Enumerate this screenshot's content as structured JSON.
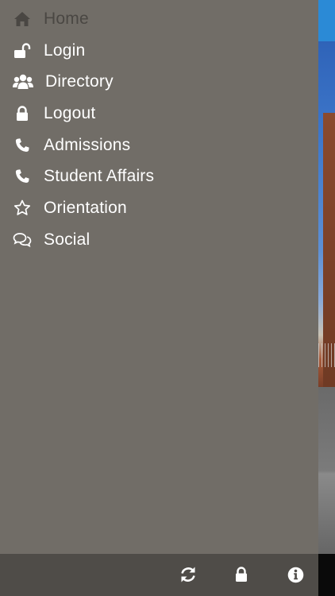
{
  "menu": {
    "items": [
      {
        "label": "Home",
        "icon": "home-icon",
        "active": true
      },
      {
        "label": "Login",
        "icon": "unlock-icon"
      },
      {
        "label": "Directory",
        "icon": "users-icon"
      },
      {
        "label": "Logout",
        "icon": "lock-icon"
      },
      {
        "label": "Admissions",
        "icon": "phone-icon"
      },
      {
        "label": "Student Affairs",
        "icon": "phone-icon"
      },
      {
        "label": "Orientation",
        "icon": "star-outline-icon"
      },
      {
        "label": "Social",
        "icon": "chat-bubbles-icon"
      }
    ]
  },
  "footer": {
    "tools": [
      {
        "name": "refresh",
        "icon": "refresh-icon"
      },
      {
        "name": "lock",
        "icon": "lock-icon"
      },
      {
        "name": "info",
        "icon": "info-icon"
      }
    ]
  },
  "colors": {
    "drawer_bg": "#716d67",
    "footer_bg": "#4f4c48",
    "active_text": "#4a4743",
    "text": "#ffffff",
    "accent_blue": "#2b8ad6"
  }
}
